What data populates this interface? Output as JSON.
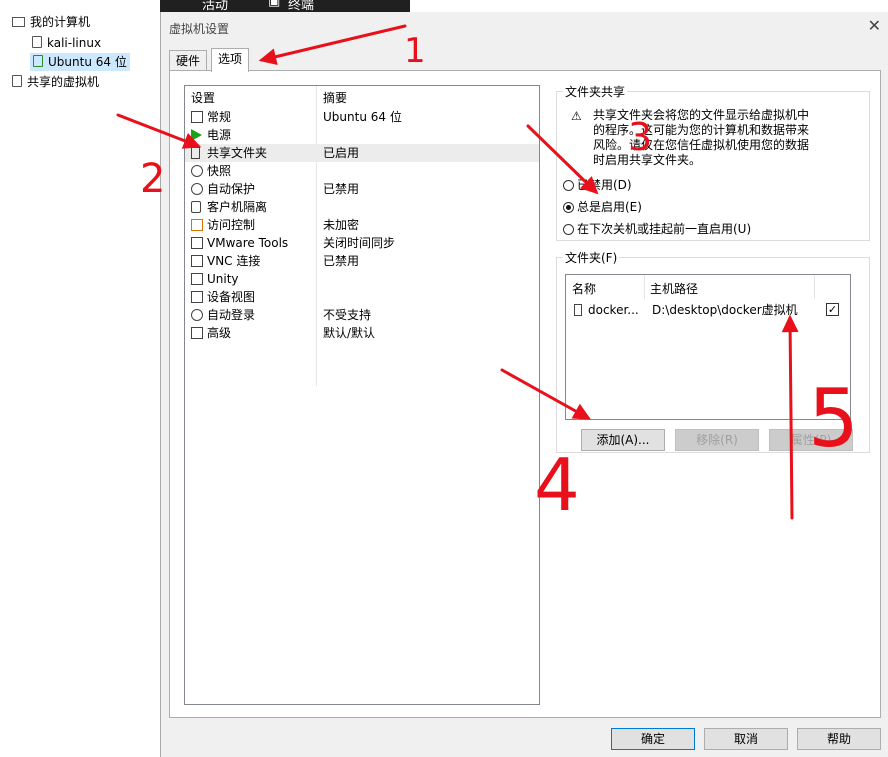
{
  "topbar": {
    "item1": "活动",
    "item2": "终端"
  },
  "library": {
    "items": [
      {
        "label": "我的计算机",
        "icon": "computer-icon"
      },
      {
        "label": "kali-linux",
        "icon": "vm-icon"
      },
      {
        "label": "Ubuntu 64 位",
        "icon": "vm-running-icon"
      },
      {
        "label": "共享的虚拟机",
        "icon": "shared-vm-icon"
      }
    ]
  },
  "dialog": {
    "title": "虚拟机设置",
    "close": "✕",
    "tabs": [
      {
        "label": "硬件"
      },
      {
        "label": "选项"
      }
    ],
    "settings_header": {
      "setting": "设置",
      "summary": "摘要"
    },
    "settings": [
      {
        "name": "常规",
        "value": "Ubuntu 64 位"
      },
      {
        "name": "电源",
        "value": ""
      },
      {
        "name": "共享文件夹",
        "value": "已启用"
      },
      {
        "name": "快照",
        "value": ""
      },
      {
        "name": "自动保护",
        "value": "已禁用"
      },
      {
        "name": "客户机隔离",
        "value": ""
      },
      {
        "name": "访问控制",
        "value": "未加密"
      },
      {
        "name": "VMware Tools",
        "value": "关闭时间同步"
      },
      {
        "name": "VNC 连接",
        "value": "已禁用"
      },
      {
        "name": "Unity",
        "value": ""
      },
      {
        "name": "设备视图",
        "value": ""
      },
      {
        "name": "自动登录",
        "value": "不受支持"
      },
      {
        "name": "高级",
        "value": "默认/默认"
      }
    ],
    "sharing": {
      "title": "文件夹共享",
      "warning": "共享文件夹会将您的文件显示给虚拟机中的程序。这可能为您的计算机和数据带来风险。请仅在您信任虚拟机使用您的数据时启用共享文件夹。",
      "options": [
        {
          "label": "已禁用(D)",
          "selected": false
        },
        {
          "label": "总是启用(E)",
          "selected": true
        },
        {
          "label": "在下次关机或挂起前一直启用(U)",
          "selected": false
        }
      ]
    },
    "folders": {
      "title": "文件夹(F)",
      "columns": {
        "name": "名称",
        "host_path": "主机路径"
      },
      "rows": [
        {
          "name": "docker...",
          "host_path": "D:\\desktop\\docker虚拟机",
          "enabled": true
        }
      ],
      "add": "添加(A)...",
      "remove": "移除(R)",
      "properties": "属性(P)"
    },
    "footer": {
      "ok": "确定",
      "cancel": "取消",
      "help": "帮助"
    }
  },
  "annotations": {
    "n1": "1",
    "n2": "2",
    "n3": "3",
    "n4": "4",
    "n5": "5",
    "color": "#e8101a"
  }
}
